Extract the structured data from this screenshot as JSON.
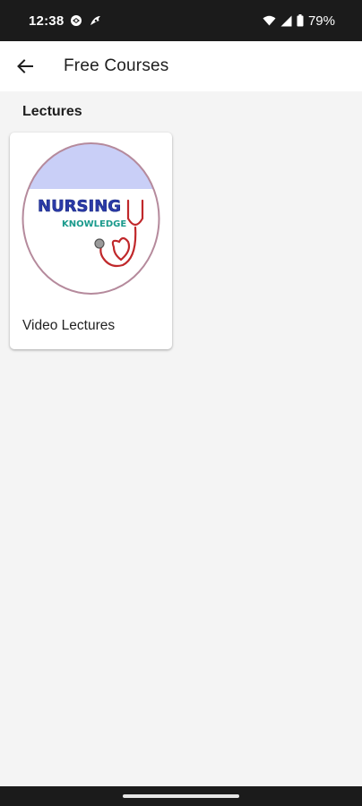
{
  "status_bar": {
    "time": "12:38",
    "battery": "79%",
    "icons": [
      "vpn-icon",
      "app-notification-icon",
      "wifi-icon",
      "cell-signal-icon",
      "battery-icon"
    ]
  },
  "app_bar": {
    "title": "Free Courses",
    "back_icon": "arrow-left-icon"
  },
  "section": {
    "title": "Lectures"
  },
  "courses": [
    {
      "label": "Video Lectures",
      "logo_text_1": "NURSING",
      "logo_text_2": "KNOWLEDGE"
    }
  ],
  "colors": {
    "status_bar_bg": "#1b1b1b",
    "app_bar_bg": "#ffffff",
    "page_bg": "#f4f4f4",
    "logo_band": "#c9cff7",
    "logo_nursing_text": "#2b3aa8",
    "logo_knowledge_text": "#1a9a8c",
    "stethoscope_red": "#c0282b"
  }
}
